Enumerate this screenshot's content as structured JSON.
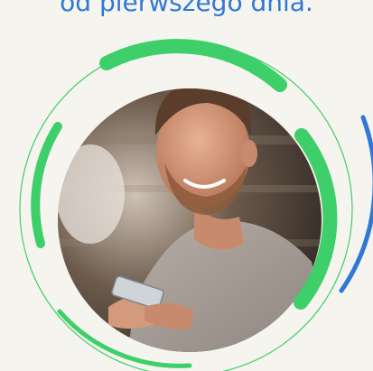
{
  "headline": "od pierwszego dnia.",
  "hero_image": {
    "description_icon": "person-photo-icon"
  },
  "colors": {
    "headline": "#2f78d6",
    "accent_green": "#3ecf6a",
    "accent_blue": "#2f78d6",
    "thin_ring": "#3ecf6a",
    "background": "#f6f4ef"
  }
}
